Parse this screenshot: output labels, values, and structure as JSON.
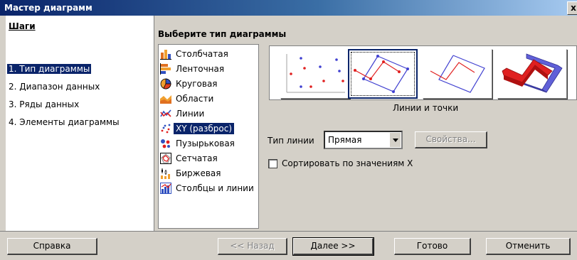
{
  "window": {
    "title": "Мастер диаграмм",
    "close_glyph": "x"
  },
  "steps": {
    "heading": "Шаги",
    "items": [
      {
        "label": "1. Тип диаграммы",
        "active": true
      },
      {
        "label": "2. Диапазон данных",
        "active": false
      },
      {
        "label": "3. Ряды данных",
        "active": false
      },
      {
        "label": "4. Элементы диаграммы",
        "active": false
      }
    ]
  },
  "main": {
    "title": "Выберите тип диаграммы",
    "chart_types": [
      {
        "label": "Столбчатая",
        "icon": "column-chart-icon"
      },
      {
        "label": "Ленточная",
        "icon": "bar-chart-icon"
      },
      {
        "label": "Круговая",
        "icon": "pie-chart-icon"
      },
      {
        "label": "Области",
        "icon": "area-chart-icon"
      },
      {
        "label": "Линии",
        "icon": "line-chart-icon"
      },
      {
        "label": "XY (разброс)",
        "icon": "xy-scatter-icon",
        "selected": true
      },
      {
        "label": "Пузырьковая",
        "icon": "bubble-chart-icon"
      },
      {
        "label": "Сетчатая",
        "icon": "net-chart-icon"
      },
      {
        "label": "Биржевая",
        "icon": "stock-chart-icon"
      },
      {
        "label": "Столбцы и линии",
        "icon": "column-line-chart-icon"
      }
    ],
    "variants_caption": "Линии и точки",
    "line_type": {
      "label": "Тип линии",
      "value": "Прямая"
    },
    "properties_button": "Свойства...",
    "sort_checkbox": {
      "label": "Сортировать по значениям X",
      "checked": false
    }
  },
  "footer": {
    "help": "Справка",
    "back": "<< Назад",
    "next": "Далее >>",
    "finish": "Готово",
    "cancel": "Отменить"
  },
  "colors": {
    "selection": "#0a246a",
    "dialog_face": "#d4d0c8",
    "point_red": "#e02020",
    "point_blue": "#4040d0"
  }
}
